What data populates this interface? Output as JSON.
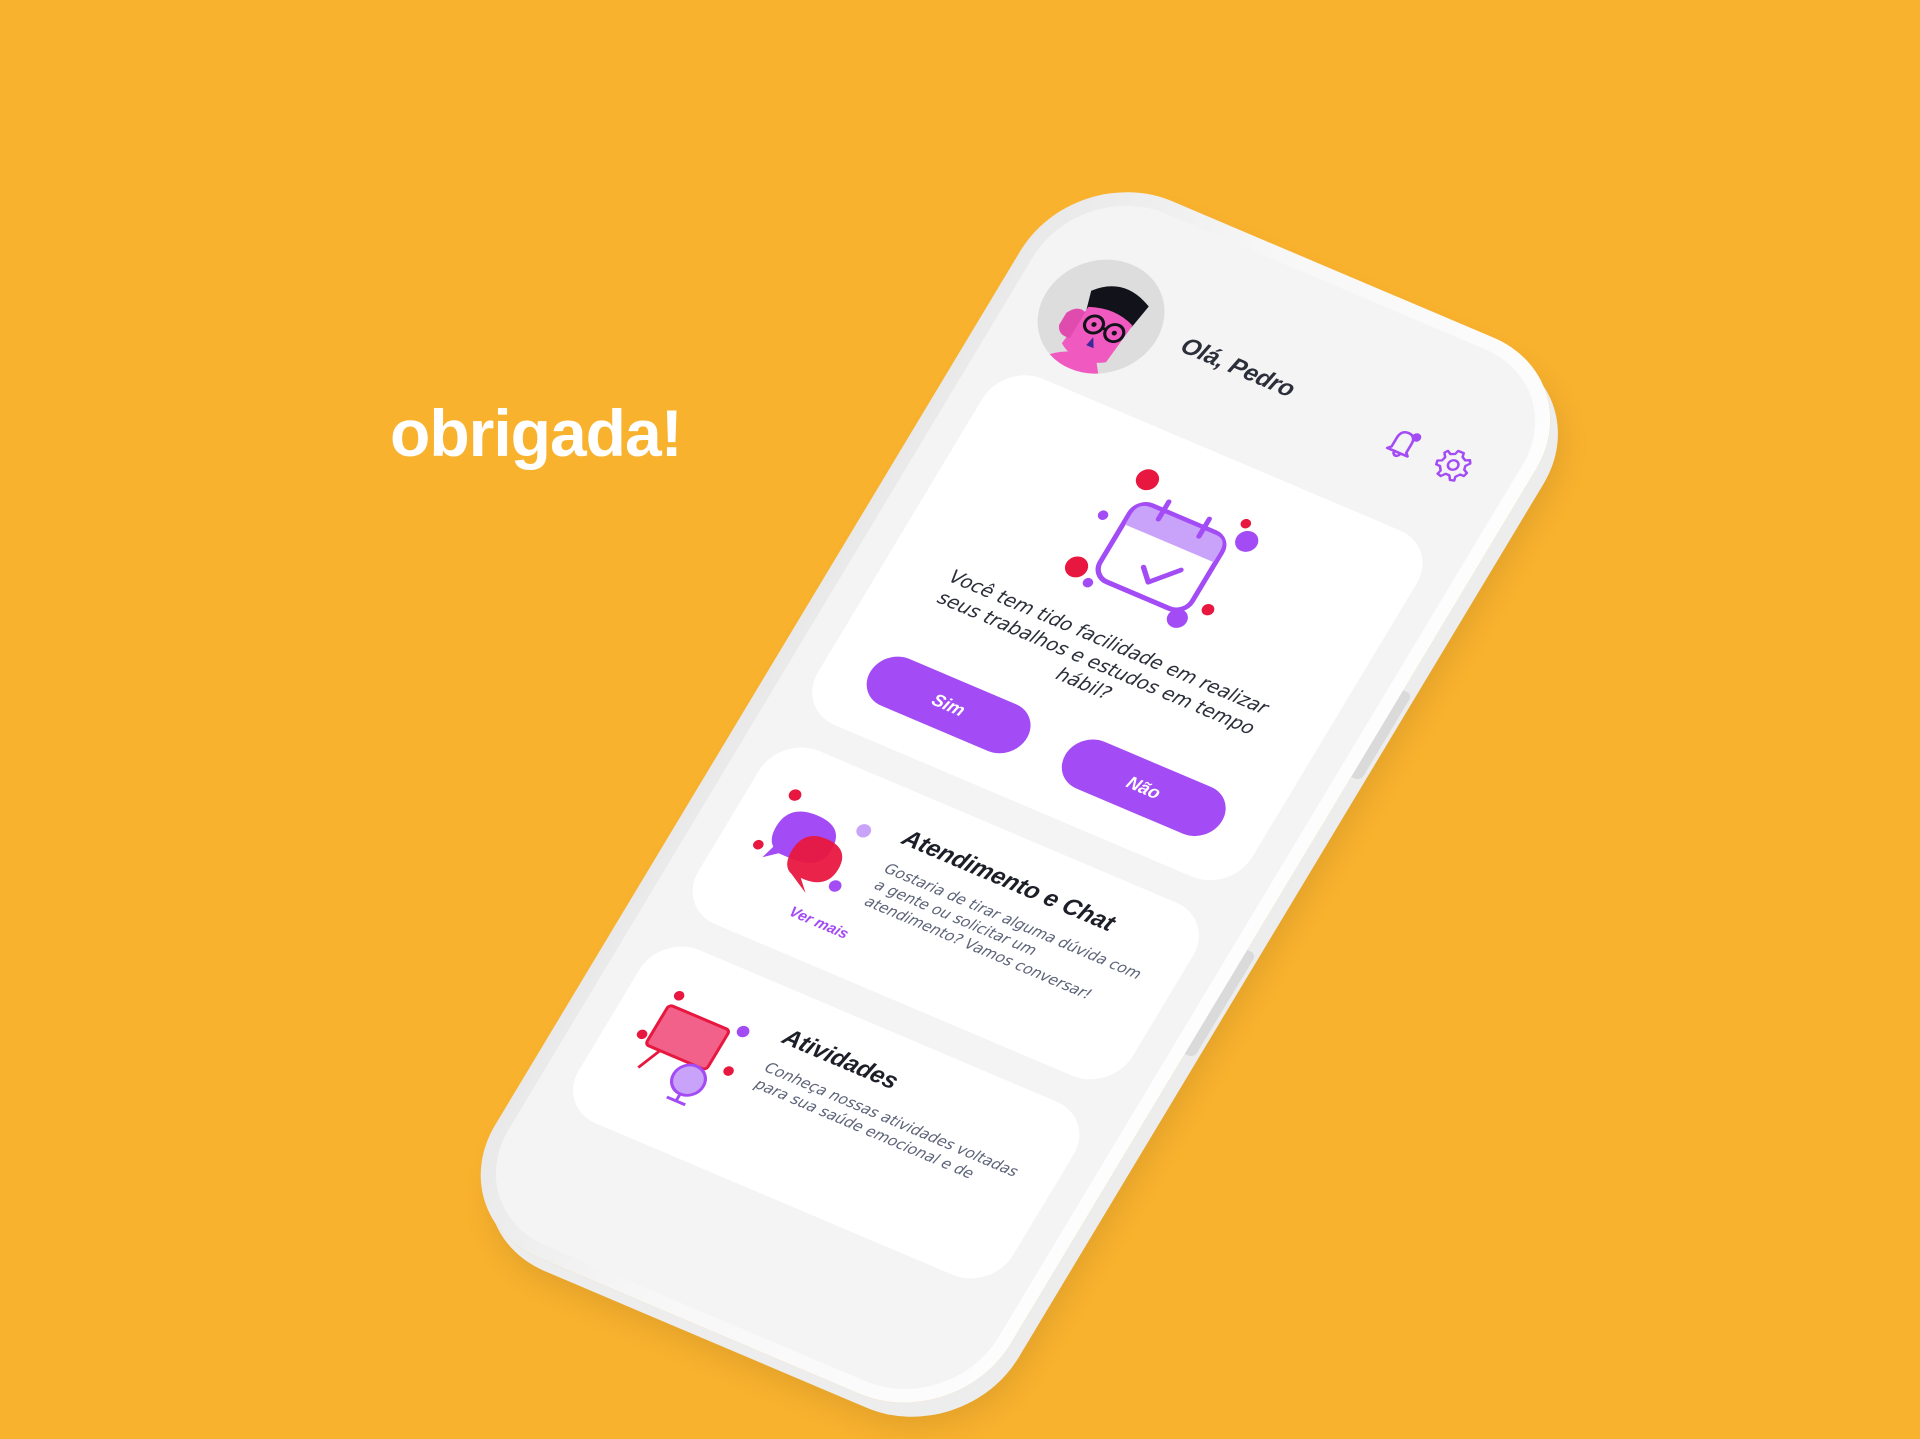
{
  "slide": {
    "thanks_text": "obrigada!"
  },
  "colors": {
    "background": "#F9B22E",
    "accent_purple": "#A34BF5",
    "accent_pink": "#F05AC0",
    "accent_red": "#E8173F"
  },
  "header": {
    "greeting": "Olá, Pedro",
    "notification_icon": "bell-icon",
    "settings_icon": "gear-icon"
  },
  "survey_card": {
    "illustration": "calendar-check-icon",
    "question": "Você tem tido facilidade em realizar seus trabalhos e estudos em tempo hábil?",
    "yes_label": "Sim",
    "no_label": "Não"
  },
  "chat_card": {
    "illustration": "chat-bubbles-icon",
    "title": "Atendimento e Chat",
    "description": "Gostaria de tirar alguma dúvida com a gente ou solicitar um atendimento? Vamos conversar!",
    "link_label": "Ver mais"
  },
  "activities_card": {
    "illustration": "easel-globe-icon",
    "title": "Atividades",
    "description": "Conheça nossas atividades voltadas para sua saúde emocional e de"
  }
}
